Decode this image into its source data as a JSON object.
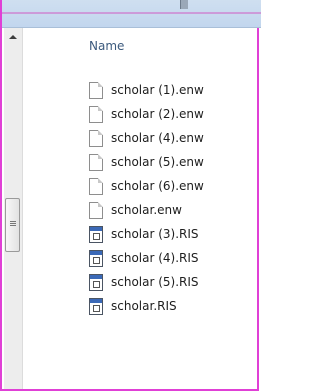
{
  "header": {
    "name_label": "Name"
  },
  "files": [
    {
      "name": "scholar (1).enw",
      "icon": "document-icon"
    },
    {
      "name": "scholar (2).enw",
      "icon": "document-icon"
    },
    {
      "name": "scholar (4).enw",
      "icon": "document-icon"
    },
    {
      "name": "scholar (5).enw",
      "icon": "document-icon"
    },
    {
      "name": "scholar (6).enw",
      "icon": "document-icon"
    },
    {
      "name": "scholar.enw",
      "icon": "document-icon"
    },
    {
      "name": "scholar (3).RIS",
      "icon": "ris-file-icon"
    },
    {
      "name": "scholar (4).RIS",
      "icon": "ris-file-icon"
    },
    {
      "name": "scholar (5).RIS",
      "icon": "ris-file-icon"
    },
    {
      "name": "scholar.RIS",
      "icon": "ris-file-icon"
    }
  ],
  "colors": {
    "header_text": "#3c5a7d",
    "border_accent": "#e040d6"
  }
}
